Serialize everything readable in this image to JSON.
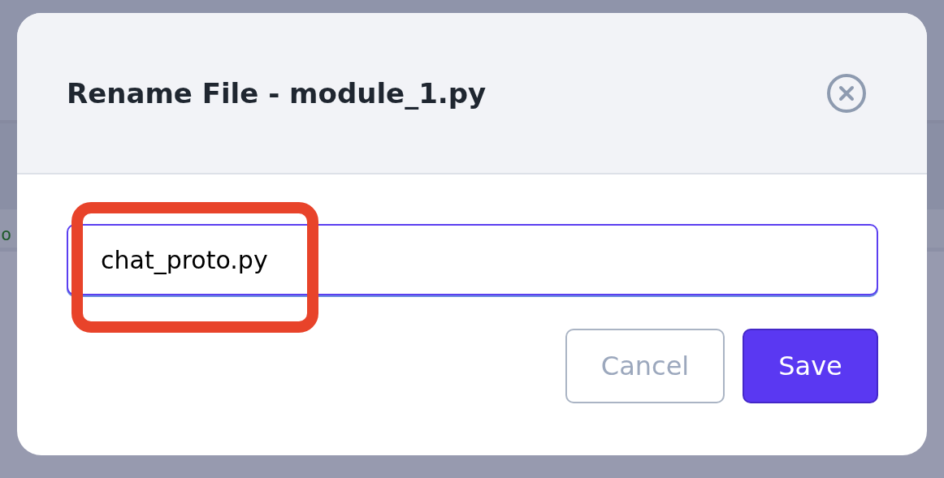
{
  "background": {
    "fragment": "o"
  },
  "dialog": {
    "title": "Rename File - module_1.py",
    "field": {
      "value": "chat_proto.py",
      "focused": true
    },
    "buttons": [
      {
        "label": "Cancel",
        "kind": "secondary"
      },
      {
        "label": "Save",
        "kind": "primary"
      }
    ]
  },
  "annotations": [
    {
      "kind": "highlight"
    }
  ]
}
